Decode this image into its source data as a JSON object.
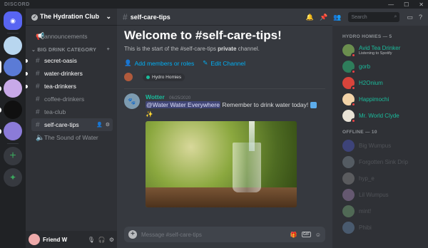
{
  "titlebar": {
    "brand": "DISCORD"
  },
  "server": {
    "name": "The Hydration Club"
  },
  "channels": {
    "top": [
      {
        "name": "announcements"
      }
    ],
    "category": "BIG DRINK CATEGORY",
    "list": [
      {
        "name": "secret-oasis"
      },
      {
        "name": "water-drinkers"
      },
      {
        "name": "tea-drinkers"
      },
      {
        "name": "coffee-drinkers"
      },
      {
        "name": "tea-club"
      },
      {
        "name": "self-care-tips"
      },
      {
        "name": "The Sound of Water"
      }
    ]
  },
  "user": {
    "name": "Friend W"
  },
  "header": {
    "channel": "self-care-tips",
    "search_placeholder": "Search"
  },
  "welcome": {
    "title": "Welcome to #self-care-tips!",
    "desc_prefix": "This is the start of the #self-care-tips ",
    "desc_bold": "private",
    "desc_suffix": " channel.",
    "add_members": "Add members or roles",
    "edit_channel": "Edit Channel",
    "role": "Hydro Homies"
  },
  "message": {
    "author": "Wotter",
    "time": "06/25/2020",
    "mention": "@Water Water Everywhere",
    "text": " Remember to drink water today! "
  },
  "composer": {
    "placeholder": "Message #self-care-tips",
    "gif": "GIF"
  },
  "members": {
    "online_header": "HYDRO HOMIES — 5",
    "online": [
      {
        "name": "Avid Tea Drinker",
        "sub": "Listening to Spotify",
        "color": "#1abc9c"
      },
      {
        "name": "gorb",
        "sub": "",
        "color": "#1abc9c"
      },
      {
        "name": "H2Onium",
        "sub": "",
        "color": "#1abc9c"
      },
      {
        "name": "Happimochi",
        "sub": "",
        "color": "#1abc9c"
      },
      {
        "name": "Mr. World Clyde",
        "sub": "",
        "color": "#1abc9c"
      }
    ],
    "offline_header": "OFFLINE — 10",
    "offline": [
      {
        "name": "Big Wumpus"
      },
      {
        "name": "Forgotten Sink Drip"
      },
      {
        "name": "hyp_e"
      },
      {
        "name": "Lil Wumpus"
      },
      {
        "name": "mint!"
      },
      {
        "name": "Phibi"
      }
    ]
  }
}
